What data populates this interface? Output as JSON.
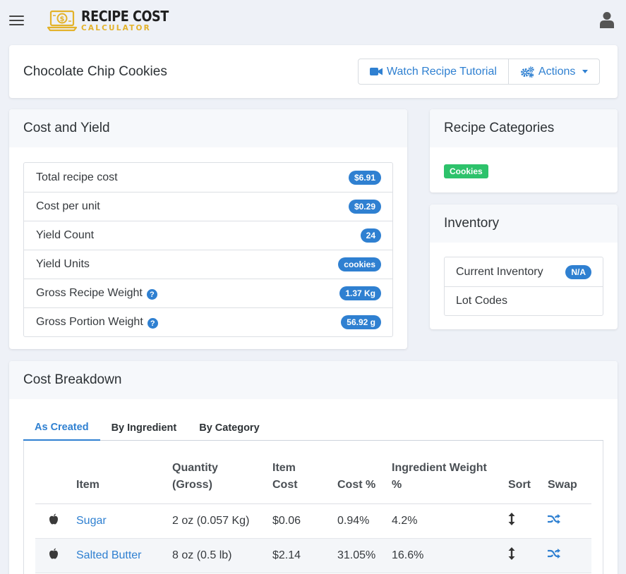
{
  "logo": {
    "line1": "RECIPE COST",
    "line2": "CALCULATOR",
    "icon": "laptop-dollar-icon"
  },
  "header": {
    "menu_icon": "hamburger-icon",
    "user_icon": "user-icon"
  },
  "recipe": {
    "title": "Chocolate Chip Cookies",
    "watch_label": "Watch Recipe Tutorial",
    "actions_label": "Actions"
  },
  "cost_yield": {
    "heading": "Cost and Yield",
    "rows": [
      {
        "label": "Total recipe cost",
        "value": "$6.91",
        "help": false
      },
      {
        "label": "Cost per unit",
        "value": "$0.29",
        "help": false
      },
      {
        "label": "Yield Count",
        "value": "24",
        "help": false
      },
      {
        "label": "Yield Units",
        "value": "cookies",
        "help": false
      },
      {
        "label": "Gross Recipe Weight",
        "value": "1.37 Kg",
        "help": true
      },
      {
        "label": "Gross Portion Weight",
        "value": "56.92 g",
        "help": true
      }
    ]
  },
  "categories": {
    "heading": "Recipe Categories",
    "tag": "Cookies"
  },
  "inventory": {
    "heading": "Inventory",
    "current_label": "Current Inventory",
    "current_value": "N/A",
    "lot_label": "Lot Codes"
  },
  "breakdown": {
    "heading": "Cost Breakdown",
    "tabs": [
      "As Created",
      "By Ingredient",
      "By Category"
    ],
    "columns": {
      "item": "Item",
      "quantity_1": "Quantity",
      "quantity_2": "(Gross)",
      "item_cost_1": "Item",
      "item_cost_2": "Cost",
      "cost_pct": "Cost %",
      "weight_pct_1": "Ingredient Weight",
      "weight_pct_2": "%",
      "sort": "Sort",
      "swap": "Swap"
    },
    "rows": [
      {
        "icon": "apple-icon",
        "item": "Sugar",
        "quantity": "2 oz (0.057 Kg)",
        "cost": "$0.06",
        "cost_pct": "0.94%",
        "weight_pct": "4.2%"
      },
      {
        "icon": "apple-icon",
        "item": "Salted Butter",
        "quantity": "8 oz (0.5 lb)",
        "cost": "$2.14",
        "cost_pct": "31.05%",
        "weight_pct": "16.6%"
      }
    ]
  },
  "colors": {
    "accent": "#2f80d1",
    "tag_green": "#2dc26b",
    "logo_gold": "#e3b22a"
  }
}
